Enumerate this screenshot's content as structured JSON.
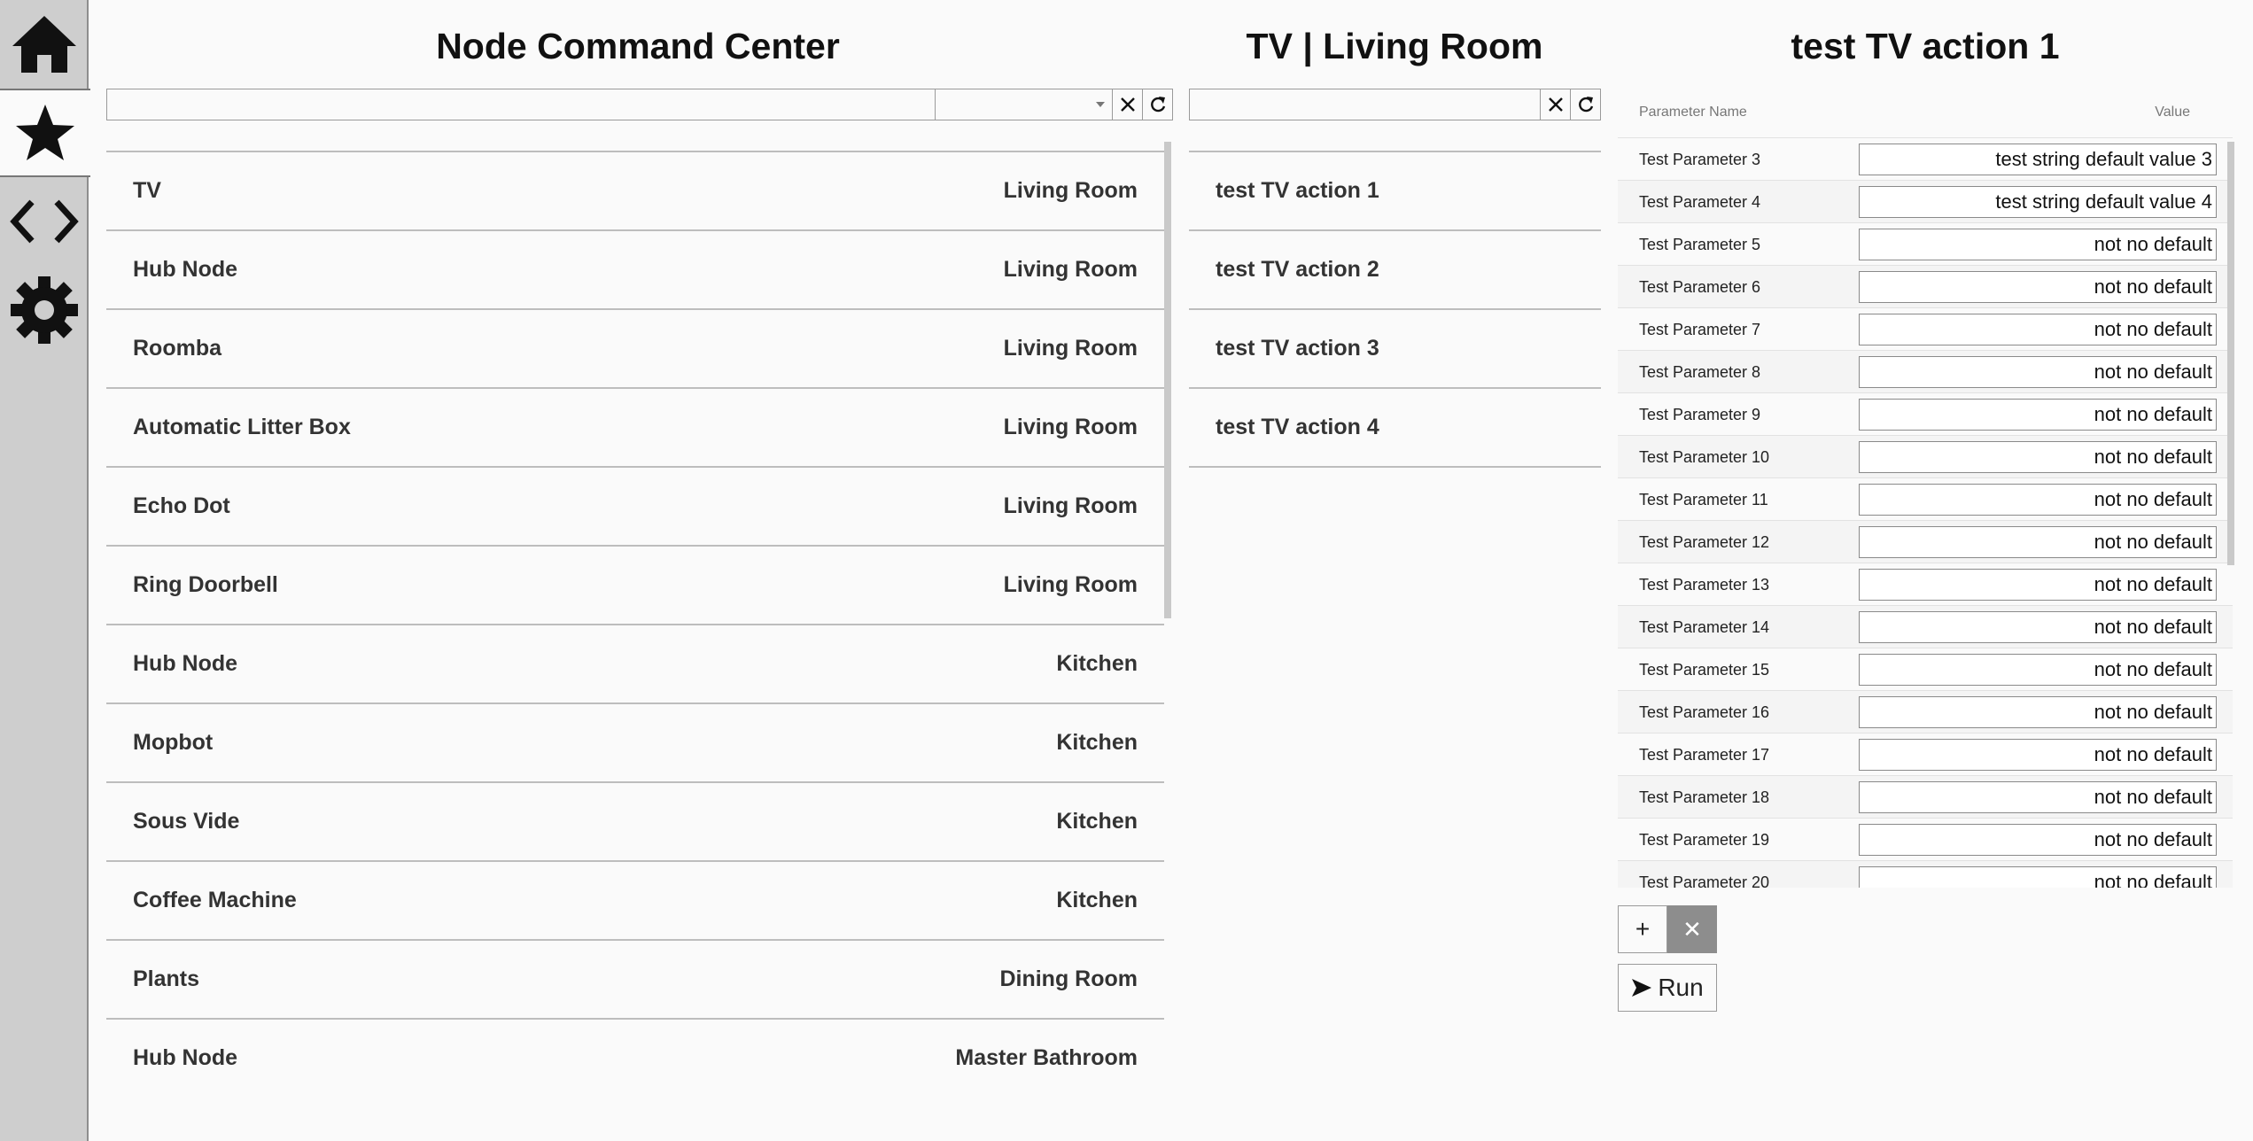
{
  "sidebar": {
    "items": [
      {
        "icon": "home-icon"
      },
      {
        "icon": "star-icon",
        "active": true
      },
      {
        "icon": "code-icon"
      },
      {
        "icon": "gear-icon"
      }
    ]
  },
  "nodes_panel": {
    "title": "Node Command Center",
    "search": {
      "value": "",
      "placeholder": ""
    },
    "filter_select": {
      "value": ""
    },
    "items": [
      {
        "name": "TV",
        "room": "Living Room"
      },
      {
        "name": "Hub Node",
        "room": "Living Room"
      },
      {
        "name": "Roomba",
        "room": "Living Room"
      },
      {
        "name": "Automatic Litter Box",
        "room": "Living Room"
      },
      {
        "name": "Echo Dot",
        "room": "Living Room"
      },
      {
        "name": "Ring Doorbell",
        "room": "Living Room"
      },
      {
        "name": "Hub Node",
        "room": "Kitchen"
      },
      {
        "name": "Mopbot",
        "room": "Kitchen"
      },
      {
        "name": "Sous Vide",
        "room": "Kitchen"
      },
      {
        "name": "Coffee Machine",
        "room": "Kitchen"
      },
      {
        "name": "Plants",
        "room": "Dining Room"
      },
      {
        "name": "Hub Node",
        "room": "Master Bathroom"
      }
    ]
  },
  "actions_panel": {
    "title": "TV | Living Room",
    "search": {
      "value": "",
      "placeholder": ""
    },
    "items": [
      {
        "name": "test TV action 1"
      },
      {
        "name": "test TV action 2"
      },
      {
        "name": "test TV action 3"
      },
      {
        "name": "test TV action 4"
      }
    ]
  },
  "action_detail": {
    "title": "test TV action 1",
    "columns": {
      "name": "Parameter Name",
      "value": "Value"
    },
    "parameters": [
      {
        "name": "Test Parameter 3",
        "value": "test string default value 3"
      },
      {
        "name": "Test Parameter 4",
        "value": "test string default value 4"
      },
      {
        "name": "Test Parameter 5",
        "value": "not no default"
      },
      {
        "name": "Test Parameter 6",
        "value": "not no default"
      },
      {
        "name": "Test Parameter 7",
        "value": "not no default"
      },
      {
        "name": "Test Parameter 8",
        "value": "not no default"
      },
      {
        "name": "Test Parameter 9",
        "value": "not no default"
      },
      {
        "name": "Test Parameter 10",
        "value": "not no default"
      },
      {
        "name": "Test Parameter 11",
        "value": "not no default"
      },
      {
        "name": "Test Parameter 12",
        "value": "not no default"
      },
      {
        "name": "Test Parameter 13",
        "value": "not no default"
      },
      {
        "name": "Test Parameter 14",
        "value": "not no default"
      },
      {
        "name": "Test Parameter 15",
        "value": "not no default"
      },
      {
        "name": "Test Parameter 16",
        "value": "not no default"
      },
      {
        "name": "Test Parameter 17",
        "value": "not no default"
      },
      {
        "name": "Test Parameter 18",
        "value": "not no default"
      },
      {
        "name": "Test Parameter 19",
        "value": "not no default"
      },
      {
        "name": "Test Parameter 20",
        "value": "not no default"
      }
    ],
    "add_label": "+",
    "remove_label": "✕",
    "run_label": "Run"
  }
}
